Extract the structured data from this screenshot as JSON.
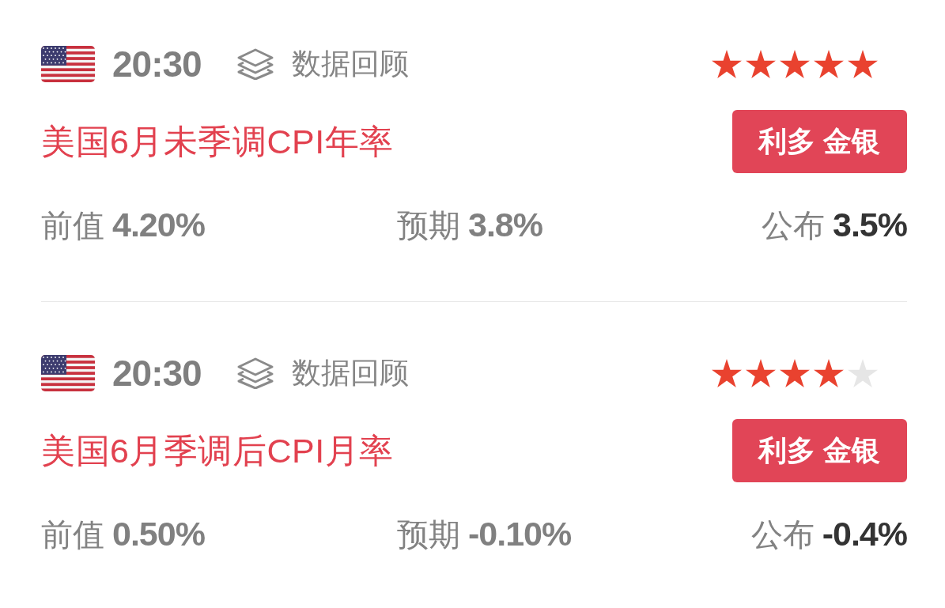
{
  "events": [
    {
      "time": "20:30",
      "category": "数据回顾",
      "stars": 5,
      "title": "美国6月未季调CPI年率",
      "badge": "利多 金银",
      "previous": {
        "label": "前值",
        "value": "4.20%"
      },
      "forecast": {
        "label": "预期",
        "value": "3.8%"
      },
      "actual": {
        "label": "公布",
        "value": "3.5%"
      }
    },
    {
      "time": "20:30",
      "category": "数据回顾",
      "stars": 4,
      "title": "美国6月季调后CPI月率",
      "badge": "利多 金银",
      "previous": {
        "label": "前值",
        "value": "0.50%"
      },
      "forecast": {
        "label": "预期",
        "value": "-0.10%"
      },
      "actual": {
        "label": "公布",
        "value": "-0.4%"
      }
    }
  ]
}
